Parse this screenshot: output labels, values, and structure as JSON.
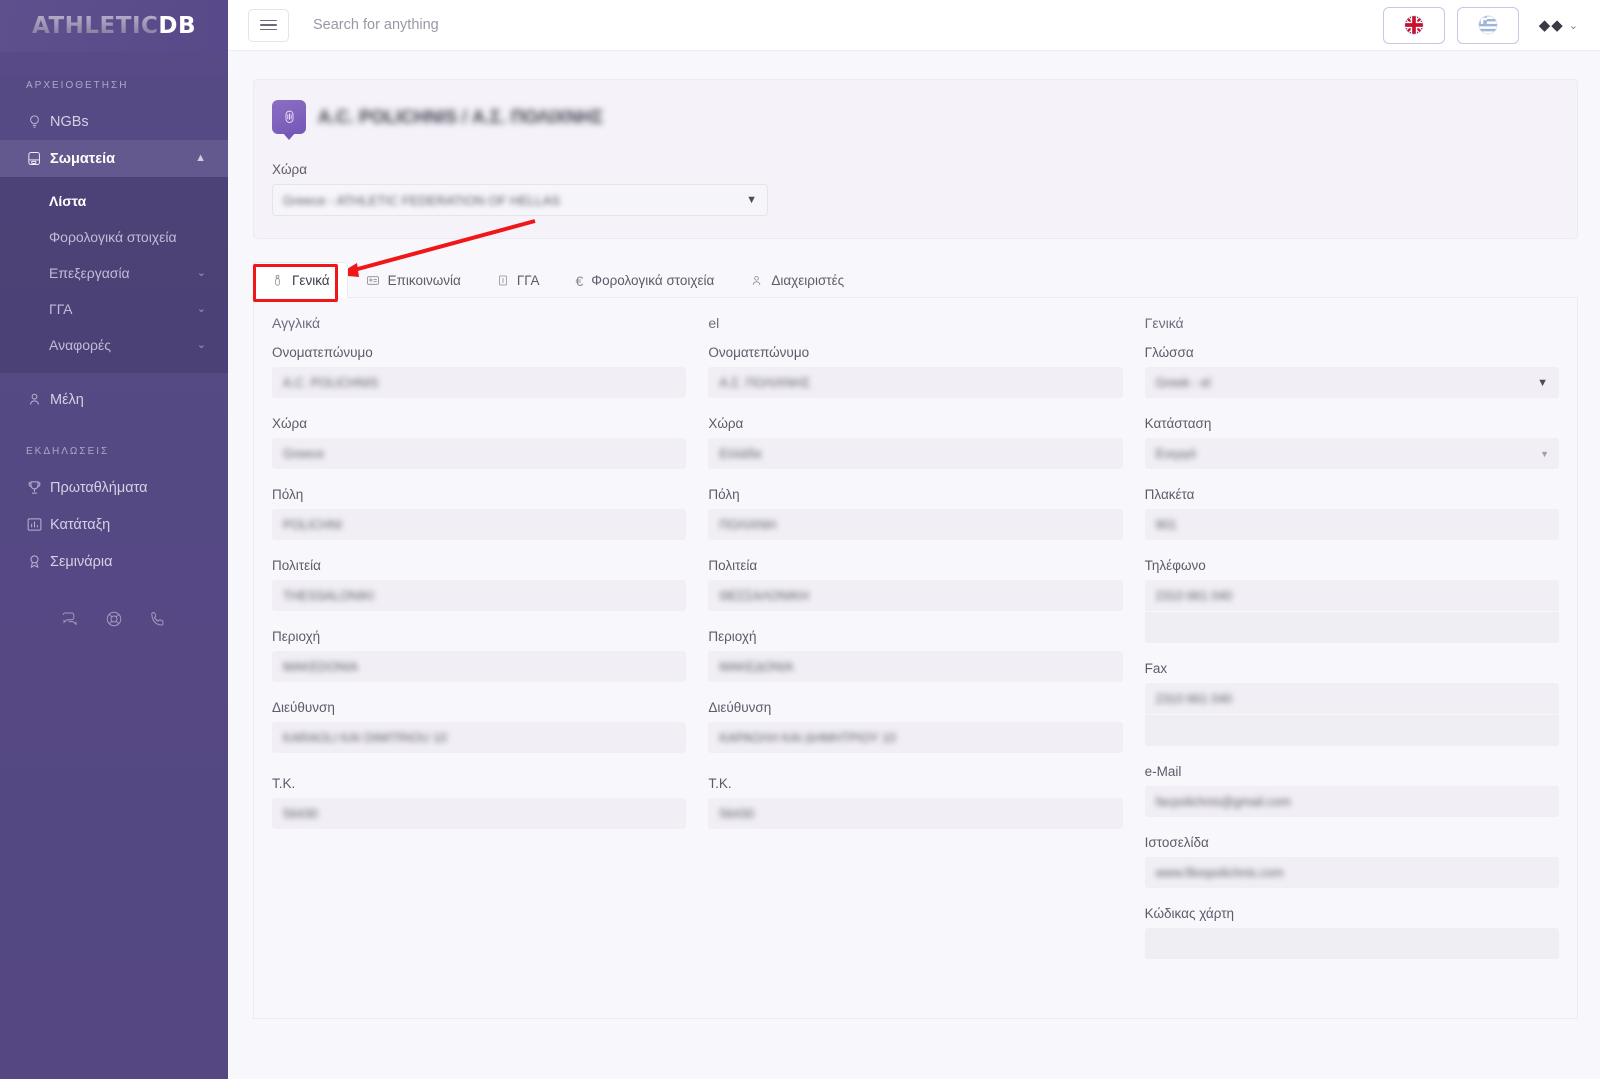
{
  "brand": {
    "part1": "ATHLETIC",
    "part2": "DB"
  },
  "sidebar": {
    "section_archive": "ΑΡΧΕΙΟΘΕΤΗΣΗ",
    "section_events": "ΕΚΔΗΛΩΣΕΙΣ",
    "items": [
      {
        "label": "NGBs",
        "icon": "bulb-icon"
      },
      {
        "label": "Σωματεία",
        "icon": "boxing-glove-icon",
        "expanded": true
      },
      {
        "label": "Μέλη",
        "icon": "member-icon"
      },
      {
        "label": "Πρωταθλήματα",
        "icon": "trophy-icon"
      },
      {
        "label": "Κατάταξη",
        "icon": "bar-chart-icon"
      },
      {
        "label": "Σεμινάρια",
        "icon": "award-icon"
      }
    ],
    "submenu": [
      {
        "label": "Λίστα",
        "active": true
      },
      {
        "label": "Φορολογικά στοιχεία",
        "active": false
      },
      {
        "label": "Επεξεργασία",
        "active": false,
        "chevron": "⌄"
      },
      {
        "label": "ΓΓΑ",
        "active": false,
        "chevron": "⌄"
      },
      {
        "label": "Αναφορές",
        "active": false,
        "chevron": "⌄"
      }
    ],
    "bottom_icons": [
      "chat-icon",
      "lifebuoy-icon",
      "phone-icon"
    ]
  },
  "topbar": {
    "search_placeholder": "Search for anything",
    "flag_en": "🇬🇧",
    "flag_el": "🇬🇷",
    "user_glyphs": "◆◆",
    "user_caret": "⌄"
  },
  "card": {
    "title": "A.C. POLICHNIS / Α.Σ. ΠΟΛΙΧΝΗΣ",
    "country_label": "Χώρα",
    "country_value": "Greece - ATHLETIC FEDERATION OF HELLAS"
  },
  "tabs": [
    {
      "label": "Γενικά",
      "icon": "person-icon",
      "active": true
    },
    {
      "label": "Επικοινωνία",
      "icon": "contact-card-icon",
      "active": false
    },
    {
      "label": "ΓΓΑ",
      "icon": "building-icon",
      "active": false
    },
    {
      "label": "Φορολογικά στοιχεία",
      "icon": "euro-icon",
      "active": false
    },
    {
      "label": "Διαχειριστές",
      "icon": "user-icon",
      "active": false
    }
  ],
  "form": {
    "col_en": {
      "heading": "Αγγλικά",
      "fields": [
        {
          "label": "Ονοματεπώνυμο",
          "value": "A.C. POLICHNIS"
        },
        {
          "label": "Χώρα",
          "value": "Greece"
        },
        {
          "label": "Πόλη",
          "value": "POLICHNI"
        },
        {
          "label": "Πολιτεία",
          "value": "THESSALONIKI"
        },
        {
          "label": "Περιοχή",
          "value": "MAKEDONIA"
        },
        {
          "label": "Διεύθυνση",
          "value": "KARAOLI KAI DIMITRIOU 10"
        },
        {
          "label": "Τ.Κ.",
          "value": "56430"
        }
      ]
    },
    "col_el": {
      "heading": "el",
      "fields": [
        {
          "label": "Ονοματεπώνυμο",
          "value": "Α.Σ. ΠΟΛΙΧΝΗΣ"
        },
        {
          "label": "Χώρα",
          "value": "Ελλάδα"
        },
        {
          "label": "Πόλη",
          "value": "ΠΟΛΙΧΝΗ"
        },
        {
          "label": "Πολιτεία",
          "value": "ΘΕΣΣΑΛΟΝΙΚΗ"
        },
        {
          "label": "Περιοχή",
          "value": "ΜΑΚΕΔΟΝΙΑ"
        },
        {
          "label": "Διεύθυνση",
          "value": "ΚΑΡΑΟΛΗ ΚΑΙ ΔΗΜΗΤΡΙΟΥ 10"
        },
        {
          "label": "Τ.Κ.",
          "value": "56430"
        }
      ]
    },
    "col_general": {
      "heading": "Γενικά",
      "language": {
        "label": "Γλώσσα",
        "value": "Greek - el"
      },
      "status": {
        "label": "Κατάσταση",
        "value": "Ενεργό"
      },
      "plaque": {
        "label": "Πλακέτα",
        "value": "901"
      },
      "phone": {
        "label": "Τηλέφωνο",
        "value": "2310 661 040",
        "value2": ""
      },
      "fax": {
        "label": "Fax",
        "value": "2310 661 040",
        "value2": ""
      },
      "email": {
        "label": "e-Mail",
        "value": "facpolichnis@gmail.com"
      },
      "website": {
        "label": "Ιστοσελίδα",
        "value": "www.filospolichnis.com"
      },
      "map_code": {
        "label": "Κώδικας χάρτη",
        "value": ""
      }
    }
  },
  "colors": {
    "sidebar": "#544782",
    "accent": "#7557b6",
    "page_bg": "#f8f7fb",
    "annotation": "#ef1717"
  }
}
